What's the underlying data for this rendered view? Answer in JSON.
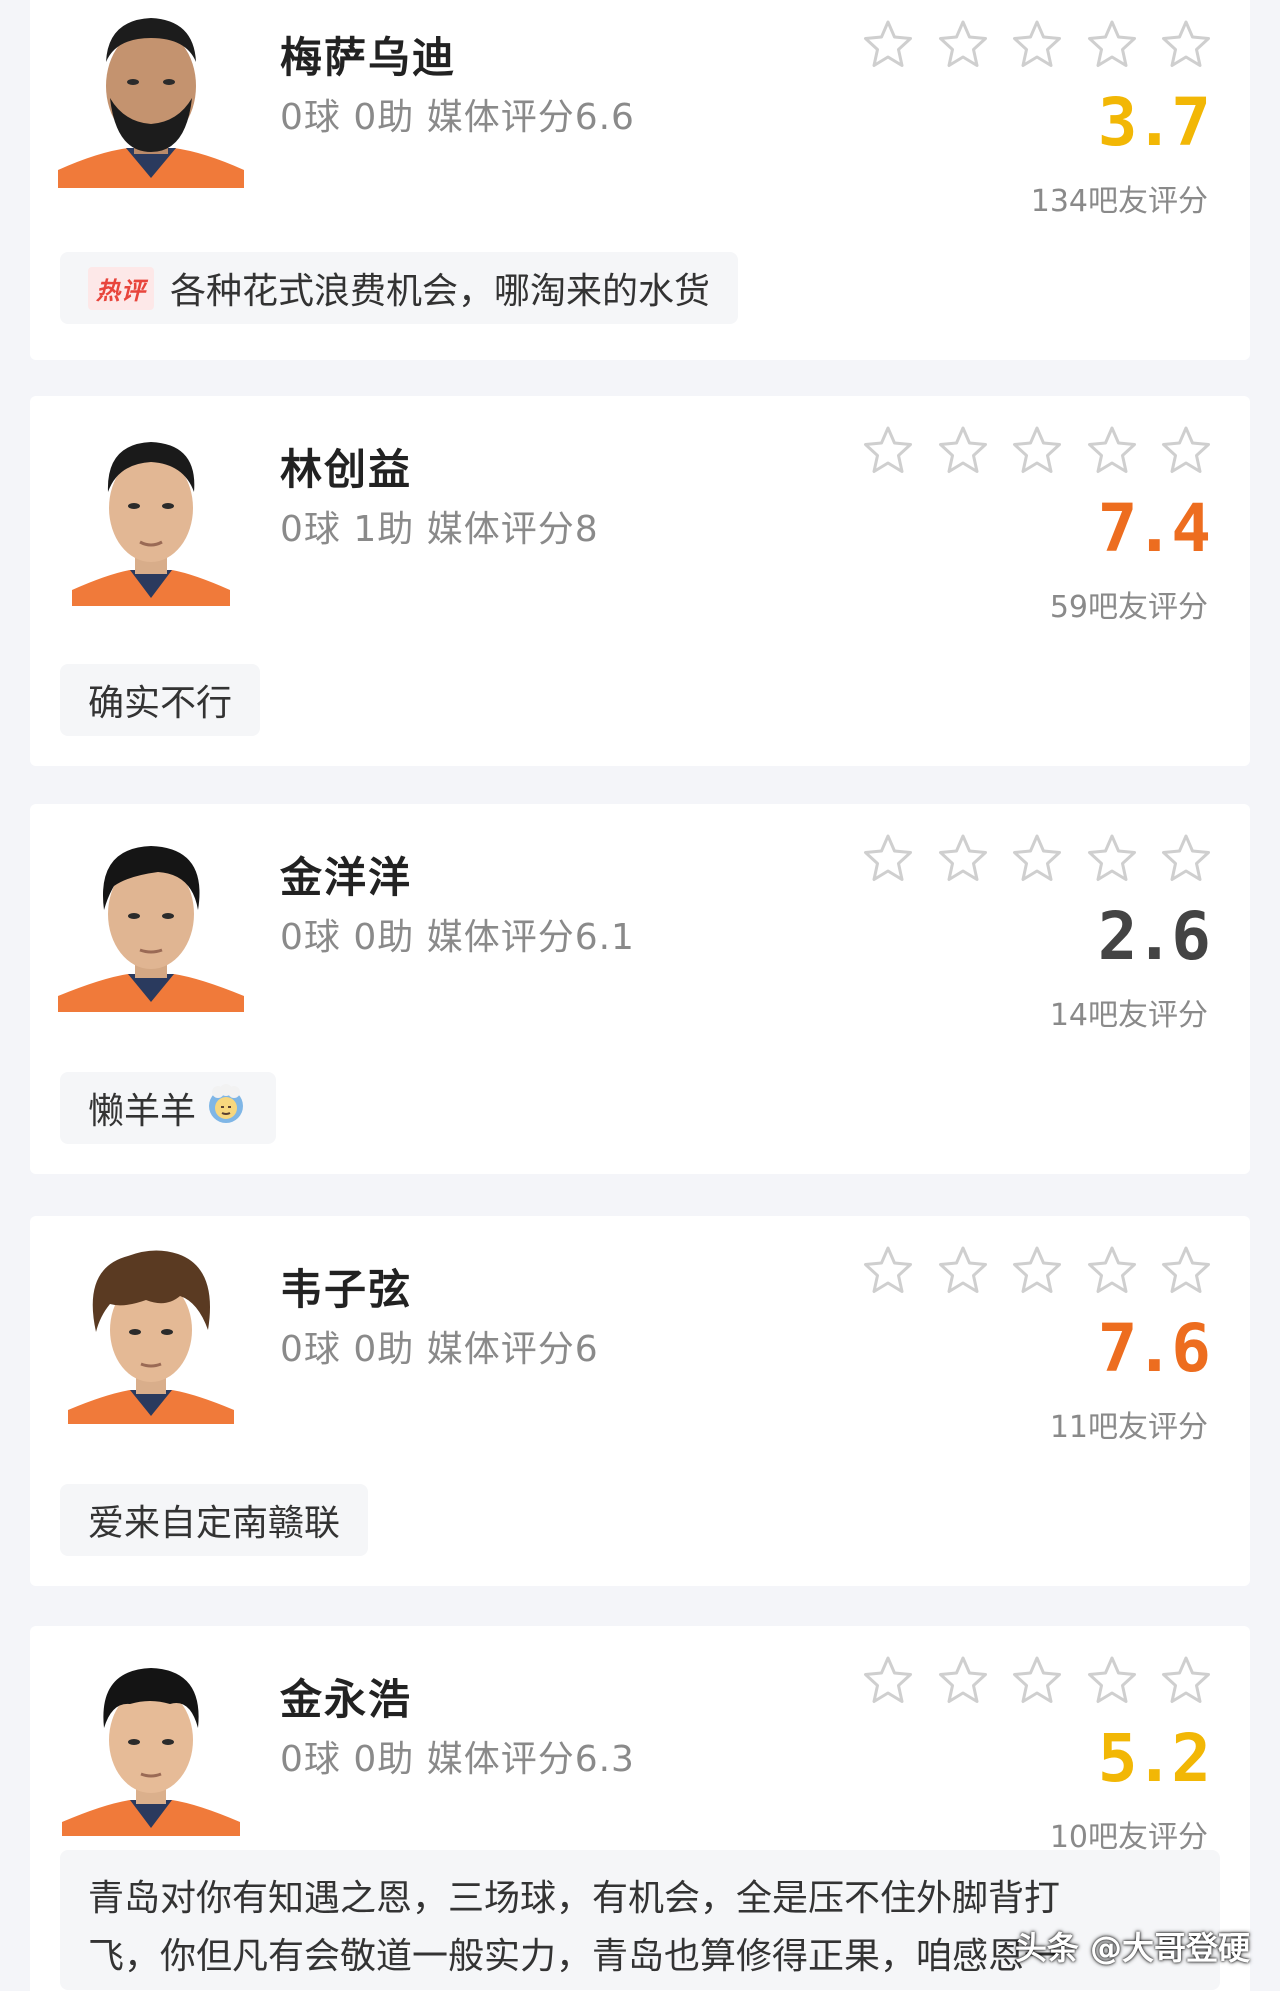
{
  "colors": {
    "score_yellow": "#f2b705",
    "score_orange": "#ed6d1f",
    "score_gray": "#444444",
    "star_outline": "#cfcfcf",
    "jersey_orange": "#f07a3a",
    "jersey_navy": "#2a3a5e"
  },
  "players": [
    {
      "name": "梅萨乌迪",
      "stats": "0球 0助  媒体评分6.6",
      "score": "3.7",
      "score_color": "#f2b705",
      "votes": "134吧友评分",
      "stars": [
        "star-outline-icon",
        "star-outline-icon",
        "star-outline-icon",
        "star-outline-icon",
        "star-outline-icon"
      ],
      "comment_badge": "热评",
      "comment": "各种花式浪费机会，哪淘来的水货"
    },
    {
      "name": "林创益",
      "stats": "0球 1助  媒体评分8",
      "score": "7.4",
      "score_color": "#ed6d1f",
      "votes": "59吧友评分",
      "stars": [
        "star-outline-icon",
        "star-outline-icon",
        "star-outline-icon",
        "star-outline-icon",
        "star-outline-icon"
      ],
      "comment": "确实不行"
    },
    {
      "name": "金洋洋",
      "stats": "0球 0助  媒体评分6.1",
      "score": "2.6",
      "score_color": "#444444",
      "votes": "14吧友评分",
      "stars": [
        "star-outline-icon",
        "star-outline-icon",
        "star-outline-icon",
        "star-outline-icon",
        "star-outline-icon"
      ],
      "comment": "懒羊羊",
      "comment_icon": "sheep-emoji-icon"
    },
    {
      "name": "韦子弦",
      "stats": "0球 0助  媒体评分6",
      "score": "7.6",
      "score_color": "#ed6d1f",
      "votes": "11吧友评分",
      "stars": [
        "star-outline-icon",
        "star-outline-icon",
        "star-outline-icon",
        "star-outline-icon",
        "star-outline-icon"
      ],
      "comment": "爱来自定南赣联"
    },
    {
      "name": "金永浩",
      "stats": "0球 0助  媒体评分6.3",
      "score": "5.2",
      "score_color": "#f2b705",
      "votes": "10吧友评分",
      "stars": [
        "star-outline-icon",
        "star-outline-icon",
        "star-outline-icon",
        "star-outline-icon",
        "star-outline-icon"
      ],
      "comment_line1": "青岛对你有知遇之恩，三场球，有机会，全是压不住外脚背打",
      "comment_line2": "飞，你但凡有会敬道一般实力，青岛也算修得正果，咱感恩一"
    }
  ],
  "watermark": "头条 @大哥登硬"
}
